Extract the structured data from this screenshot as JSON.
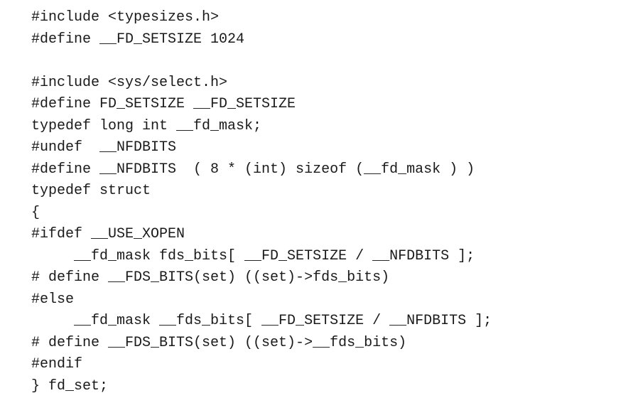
{
  "code": {
    "lines": [
      "#include <typesizes.h>",
      "#define __FD_SETSIZE 1024",
      "",
      "#include <sys/select.h>",
      "#define FD_SETSIZE __FD_SETSIZE",
      "typedef long int __fd_mask;",
      "#undef  __NFDBITS",
      "#define __NFDBITS  ( 8 * (int) sizeof (__fd_mask ) )",
      "typedef struct",
      "{",
      "#ifdef __USE_XOPEN",
      "     __fd_mask fds_bits[ __FD_SETSIZE / __NFDBITS ];",
      "# define __FDS_BITS(set) ((set)->fds_bits)",
      "#else",
      "     __fd_mask __fds_bits[ __FD_SETSIZE / __NFDBITS ];",
      "# define __FDS_BITS(set) ((set)->__fds_bits)",
      "#endif",
      "} fd_set;"
    ]
  }
}
